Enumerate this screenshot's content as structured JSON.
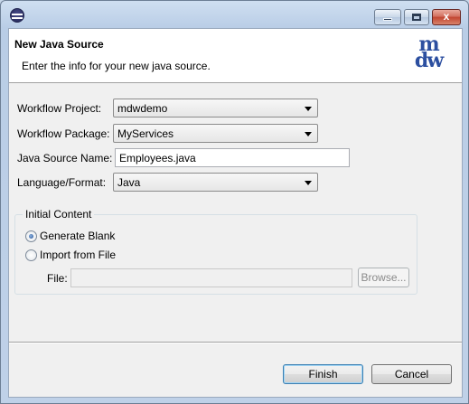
{
  "window": {
    "minimize_glyph": "minimize-icon",
    "maximize_glyph": "maximize-icon",
    "close_glyph": "x"
  },
  "header": {
    "title": "New Java Source",
    "description": "Enter the info for your new java source.",
    "logo_line1": "m",
    "logo_line2": "dw"
  },
  "form": {
    "project_label": "Workflow Project:",
    "project_value": "mdwdemo",
    "package_label": "Workflow Package:",
    "package_value": "MyServices",
    "name_label": "Java Source Name:",
    "name_value": "Employees.java",
    "language_label": "Language/Format:",
    "language_value": "Java"
  },
  "initial_content": {
    "title": "Initial Content",
    "option_blank": "Generate Blank",
    "option_import": "Import from File",
    "selected": "Generate Blank",
    "file_label": "File:",
    "file_value": "",
    "browse_label": "Browse..."
  },
  "footer": {
    "finish_label": "Finish",
    "cancel_label": "Cancel"
  }
}
